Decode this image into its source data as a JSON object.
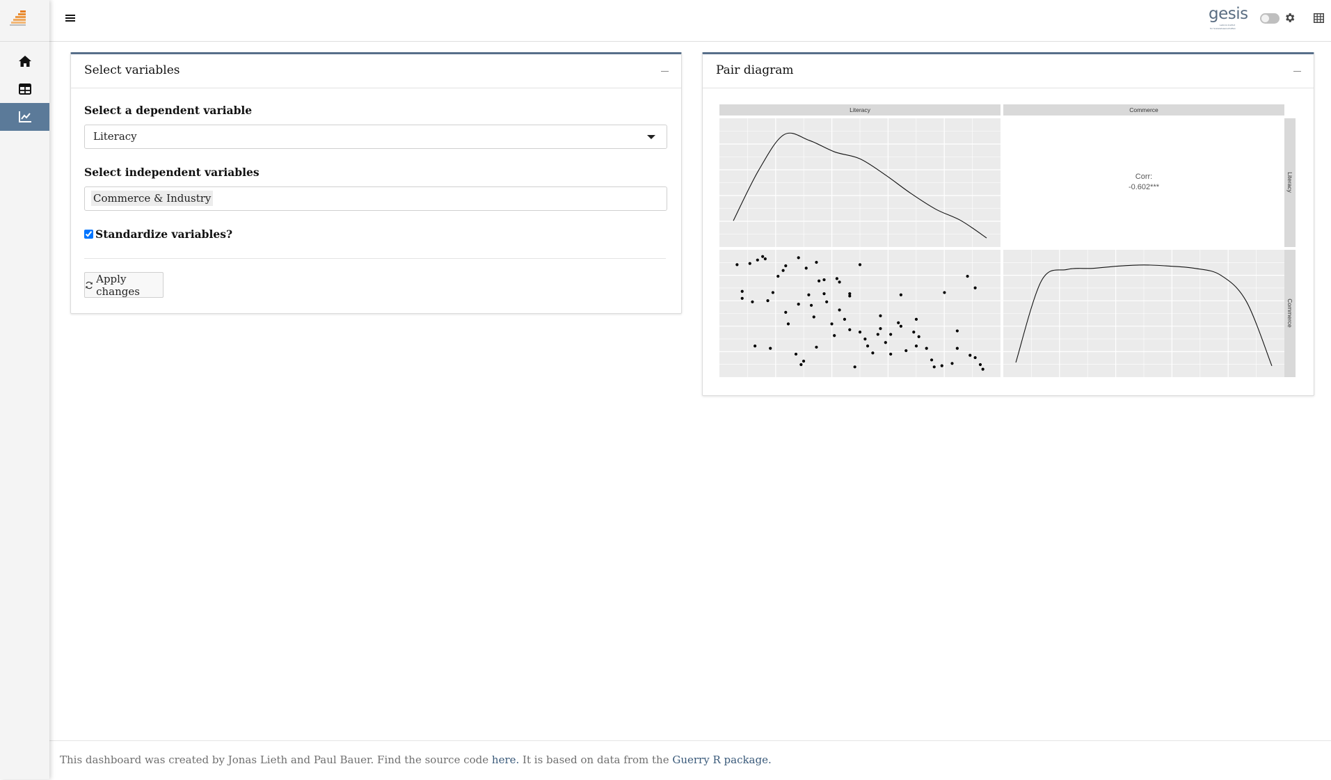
{
  "sidebar": {
    "items": [
      {
        "icon": "home-icon",
        "active": false
      },
      {
        "icon": "table-icon",
        "active": false
      },
      {
        "icon": "chart-line-icon",
        "active": true
      }
    ]
  },
  "header": {
    "logo_text": "gesis",
    "logo_sub1": "Leibniz-Institut",
    "logo_sub2": "für Sozialwissenschaften",
    "dark_mode_on": false
  },
  "vars_card": {
    "title": "Select variables",
    "dependent_label": "Select a dependent variable",
    "dependent_value": "Literacy",
    "independent_label": "Select independent variables",
    "independent_values": [
      "Commerce & Industry"
    ],
    "standardize_label": "Standardize variables?",
    "standardize_checked": true,
    "apply_label": "Apply changes"
  },
  "pair_card": {
    "title": "Pair diagram"
  },
  "chart_data": {
    "type": "pair-plot",
    "variables": [
      "Literacy",
      "Commerce"
    ],
    "corr_label": "Corr:",
    "corr_value": "-0.602***",
    "density_literacy": {
      "x": [
        0,
        0.1,
        0.2,
        0.3,
        0.4,
        0.5,
        0.6,
        0.7,
        0.8,
        0.9,
        1.0
      ],
      "y": [
        0.18,
        0.62,
        0.93,
        0.88,
        0.78,
        0.72,
        0.58,
        0.42,
        0.28,
        0.18,
        0.03
      ]
    },
    "density_commerce": {
      "x": [
        0,
        0.1,
        0.2,
        0.3,
        0.4,
        0.5,
        0.6,
        0.7,
        0.8,
        0.9,
        1.0
      ],
      "y": [
        0.08,
        0.8,
        0.9,
        0.91,
        0.93,
        0.94,
        0.93,
        0.91,
        0.85,
        0.62,
        0.05
      ]
    },
    "scatter_points": [
      [
        0.02,
        0.92
      ],
      [
        0.07,
        0.93
      ],
      [
        0.1,
        0.96
      ],
      [
        0.12,
        0.99
      ],
      [
        0.13,
        0.97
      ],
      [
        0.18,
        0.82
      ],
      [
        0.2,
        0.87
      ],
      [
        0.21,
        0.91
      ],
      [
        0.26,
        0.98
      ],
      [
        0.29,
        0.89
      ],
      [
        0.33,
        0.94
      ],
      [
        0.34,
        0.78
      ],
      [
        0.41,
        0.8
      ],
      [
        0.42,
        0.77
      ],
      [
        0.46,
        0.65
      ],
      [
        0.5,
        0.92
      ],
      [
        0.58,
        0.48
      ],
      [
        0.66,
        0.66
      ],
      [
        0.72,
        0.45
      ],
      [
        0.83,
        0.68
      ],
      [
        0.92,
        0.82
      ],
      [
        0.95,
        0.72
      ],
      [
        0.04,
        0.63
      ],
      [
        0.04,
        0.69
      ],
      [
        0.08,
        0.6
      ],
      [
        0.14,
        0.61
      ],
      [
        0.16,
        0.68
      ],
      [
        0.21,
        0.51
      ],
      [
        0.22,
        0.41
      ],
      [
        0.26,
        0.58
      ],
      [
        0.3,
        0.66
      ],
      [
        0.31,
        0.57
      ],
      [
        0.32,
        0.47
      ],
      [
        0.36,
        0.79
      ],
      [
        0.36,
        0.67
      ],
      [
        0.37,
        0.6
      ],
      [
        0.39,
        0.41
      ],
      [
        0.42,
        0.53
      ],
      [
        0.44,
        0.45
      ],
      [
        0.46,
        0.67
      ],
      [
        0.5,
        0.34
      ],
      [
        0.52,
        0.28
      ],
      [
        0.55,
        0.16
      ],
      [
        0.57,
        0.32
      ],
      [
        0.58,
        0.37
      ],
      [
        0.6,
        0.25
      ],
      [
        0.62,
        0.32
      ],
      [
        0.65,
        0.42
      ],
      [
        0.68,
        0.18
      ],
      [
        0.72,
        0.22
      ],
      [
        0.76,
        0.2
      ],
      [
        0.78,
        0.1
      ],
      [
        0.82,
        0.05
      ],
      [
        0.86,
        0.07
      ],
      [
        0.88,
        0.2
      ],
      [
        0.93,
        0.14
      ],
      [
        0.95,
        0.12
      ],
      [
        0.97,
        0.06
      ],
      [
        0.27,
        0.06
      ],
      [
        0.33,
        0.21
      ],
      [
        0.15,
        0.2
      ],
      [
        0.09,
        0.22
      ],
      [
        0.4,
        0.31
      ],
      [
        0.46,
        0.36
      ],
      [
        0.53,
        0.22
      ],
      [
        0.62,
        0.15
      ],
      [
        0.73,
        0.3
      ],
      [
        0.79,
        0.04
      ],
      [
        0.88,
        0.35
      ],
      [
        0.98,
        0.02
      ],
      [
        0.48,
        0.04
      ],
      [
        0.25,
        0.15
      ],
      [
        0.28,
        0.09
      ],
      [
        0.66,
        0.39
      ],
      [
        0.71,
        0.34
      ]
    ]
  },
  "footer": {
    "text_before": "This dashboard was created by Jonas Lieth and Paul Bauer. Find the source code",
    "link1": "here.",
    "text_middle": "It is based on data from the",
    "link2": "Guerry R package."
  }
}
